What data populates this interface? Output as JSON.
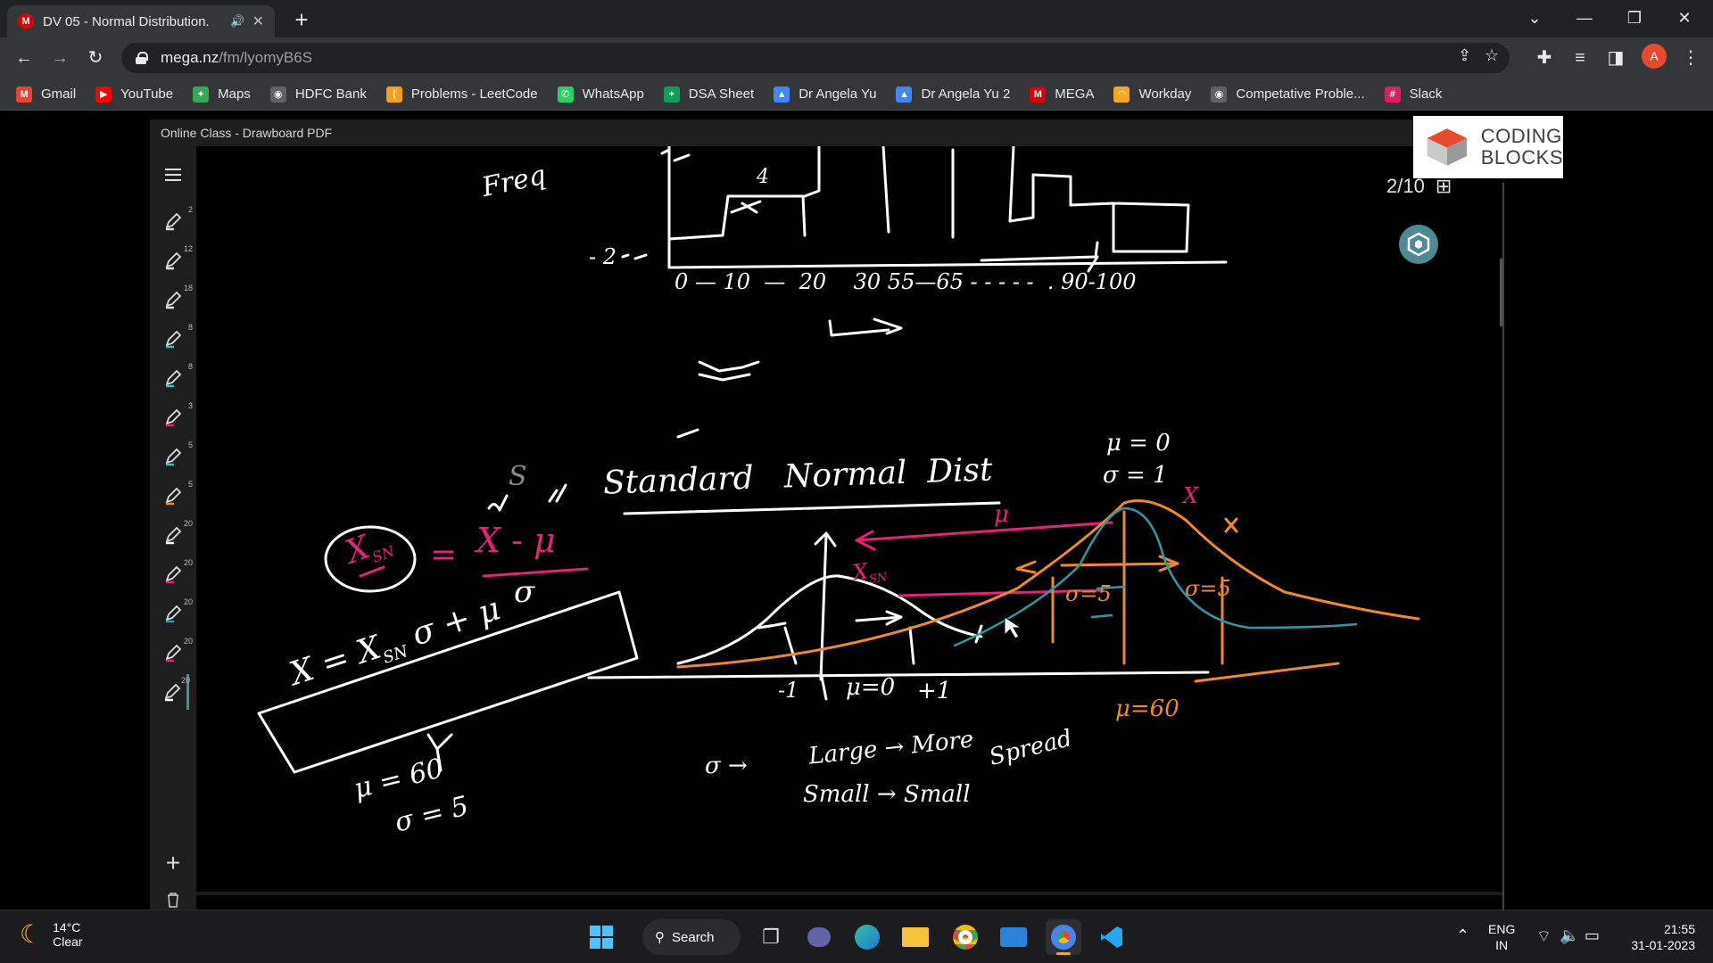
{
  "browser": {
    "tab_title": "DV 05 - Normal Distribution.",
    "tab_favicon": "M",
    "new_tab_label": "+",
    "url_host": "mega.nz",
    "url_path": "/fm/lyomyB6S",
    "profile_initial": "A"
  },
  "bookmarks": [
    {
      "label": "Gmail",
      "icon": "gmail-icon",
      "color": "#ea4335",
      "glyph": "M"
    },
    {
      "label": "YouTube",
      "icon": "youtube-icon",
      "color": "#ff0000",
      "glyph": "▶"
    },
    {
      "label": "Maps",
      "icon": "maps-icon",
      "color": "#34a853",
      "glyph": "✦"
    },
    {
      "label": "HDFC Bank",
      "icon": "globe-icon",
      "color": "#5f6368",
      "glyph": "◉"
    },
    {
      "label": "Problems - LeetCode",
      "icon": "leetcode-icon",
      "color": "#f89f1b",
      "glyph": "⟨"
    },
    {
      "label": "WhatsApp",
      "icon": "whatsapp-icon",
      "color": "#25d366",
      "glyph": "✆"
    },
    {
      "label": "DSA Sheet",
      "icon": "sheets-icon",
      "color": "#0f9d58",
      "glyph": "+"
    },
    {
      "label": "Dr Angela Yu",
      "icon": "drive-icon",
      "color": "#4285f4",
      "glyph": "▲"
    },
    {
      "label": "Dr Angela Yu 2",
      "icon": "drive-icon",
      "color": "#4285f4",
      "glyph": "▲"
    },
    {
      "label": "MEGA",
      "icon": "mega-icon",
      "color": "#d90007",
      "glyph": "M"
    },
    {
      "label": "Workday",
      "icon": "workday-icon",
      "color": "#f5a623",
      "glyph": "◠"
    },
    {
      "label": "Competative Proble...",
      "icon": "globe-icon",
      "color": "#5f6368",
      "glyph": "◉"
    },
    {
      "label": "Slack",
      "icon": "slack-icon",
      "color": "#e01e5a",
      "glyph": "#"
    }
  ],
  "app": {
    "window_title": "Online Class - Drawboard PDF",
    "page_indicator": "2/10",
    "logo_line1": "CODING",
    "logo_line2": "BLOCKS",
    "tool_numbers": [
      "2",
      "12",
      "18",
      "8",
      "8",
      "3",
      "5",
      "5",
      "20",
      "20",
      "20",
      "20",
      "20"
    ],
    "add_label": "+"
  },
  "board_text": {
    "freq": "Freq",
    "num4": "4",
    "neg2": "- 2",
    "x_axis": "0 — 10  —  20    30 55—65 - - - - -  . 90-100",
    "title": "Standard   Normal  Dist",
    "mu0": "μ = 0",
    "sigma1": "σ = 1",
    "x_mark": "X",
    "s_mark": "S",
    "xsn_circle": "X",
    "xsn_sub": "SN",
    "eq_sign": "=",
    "frac_num": "X - μ",
    "frac_den": "σ",
    "boxed_formula": "X = X",
    "boxed_sub": "SN",
    "boxed_tail": "σ + μ",
    "mu_pink": "μ",
    "xsn_pink": "X",
    "xsn_pink_sub": "SN",
    "tick_m1": "-1",
    "tick_mu": "μ=0",
    "tick_p1": "+1",
    "mu60_orange": "μ=60",
    "sig5_left": "σ=5",
    "sig5_right": "σ=5",
    "mu_60": "μ = 60",
    "sigma_5": "σ = 5",
    "sigma_arrow": "σ →",
    "large_line": "Large → More",
    "spread": "Spread",
    "small_line": "Small → Small"
  },
  "taskbar": {
    "temp": "14°C",
    "weather": "Clear",
    "search_label": "Search",
    "lang1": "ENG",
    "lang2": "IN",
    "time": "21:55",
    "date": "31-01-2023"
  },
  "colors": {
    "ink_white": "#ffffff",
    "ink_pink": "#e8207a",
    "ink_orange": "#f08a24",
    "ink_teal": "#2a9aa8",
    "accent_teal": "#4d8a93"
  }
}
